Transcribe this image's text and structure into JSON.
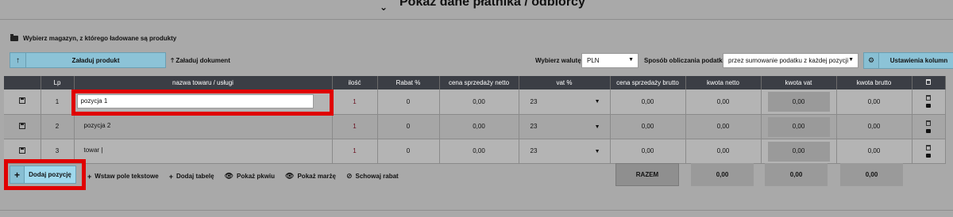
{
  "header": {
    "title": "Pokaż dane płatnika / odbiorcy"
  },
  "warehouse": {
    "label": "Wybierz magazyn, z którego ładowane są produkty"
  },
  "toolbar": {
    "upload_product": "Załaduj produkt",
    "upload_document": "Załaduj dokument",
    "currency_label": "Wybierz walutę",
    "currency_value": "PLN",
    "tax_label": "Sposób obliczania podatku",
    "tax_value": "przez sumowanie podatku z każdej pozycji",
    "settings_label": "Ustawienia kolumn"
  },
  "table": {
    "headers": [
      "Lp",
      "nazwa towaru / usługi",
      "ilość",
      "Rabat %",
      "cena sprzedaży netto",
      "vat %",
      "cena sprzedaży brutto",
      "kwota netto",
      "kwota vat",
      "kwota brutto"
    ],
    "rows": [
      {
        "lp": "1",
        "name": "pozycja 1",
        "qty": "1",
        "rabat": "0",
        "net": "0,00",
        "vat": "23",
        "gross": "0,00",
        "kw_net": "0,00",
        "kw_vat": "0,00",
        "kw_brut": "0,00"
      },
      {
        "lp": "2",
        "name": "pozycja 2",
        "qty": "1",
        "rabat": "0",
        "net": "0,00",
        "vat": "23",
        "gross": "0,00",
        "kw_net": "0,00",
        "kw_vat": "0,00",
        "kw_brut": "0,00"
      },
      {
        "lp": "3",
        "name": "towar |",
        "qty": "1",
        "rabat": "0",
        "net": "0,00",
        "vat": "23",
        "gross": "0,00",
        "kw_net": "0,00",
        "kw_vat": "0,00",
        "kw_brut": "0,00"
      }
    ]
  },
  "actions": {
    "add_position": "Dodaj pozycję",
    "insert_text": "Wstaw pole tekstowe",
    "add_table": "Dodaj tabelę",
    "show_pkwiu": "Pokaż pkwiu",
    "show_margin": "Pokaż marżę",
    "hide_discount": "Schowaj rabat"
  },
  "totals": {
    "label": "RAZEM",
    "net": "0,00",
    "vat": "0,00",
    "gross": "0,00"
  },
  "colors": {
    "highlight": "#e00000",
    "button": "#8cc3d7",
    "header": "#3b3e45"
  }
}
